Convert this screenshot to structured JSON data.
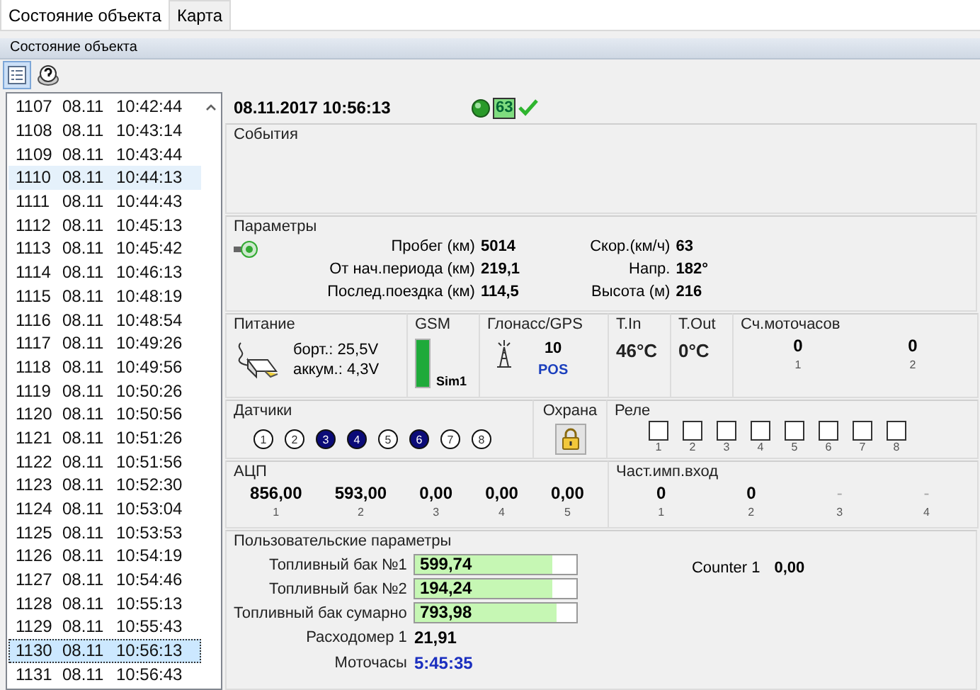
{
  "tabs": [
    {
      "label": "Состояние объекта",
      "selected": true
    },
    {
      "label": "Карта",
      "selected": false
    }
  ],
  "panel_title": "Состояние объекта",
  "toolbar": [
    {
      "kind": "list",
      "selected": true
    },
    {
      "kind": "help",
      "selected": false
    }
  ],
  "records": [
    {
      "number": "1107",
      "date": "08.11",
      "time": "10:42:44",
      "selected": false,
      "hovered": false
    },
    {
      "number": "1108",
      "date": "08.11",
      "time": "10:43:14",
      "selected": false,
      "hovered": false
    },
    {
      "number": "1109",
      "date": "08.11",
      "time": "10:43:44",
      "selected": false,
      "hovered": false
    },
    {
      "number": "1110",
      "date": "08.11",
      "time": "10:44:13",
      "selected": false,
      "hovered": true
    },
    {
      "number": "1111",
      "date": "08.11",
      "time": "10:44:43",
      "selected": false,
      "hovered": false
    },
    {
      "number": "1112",
      "date": "08.11",
      "time": "10:45:13",
      "selected": false,
      "hovered": false
    },
    {
      "number": "1113",
      "date": "08.11",
      "time": "10:45:42",
      "selected": false,
      "hovered": false
    },
    {
      "number": "1114",
      "date": "08.11",
      "time": "10:46:13",
      "selected": false,
      "hovered": false
    },
    {
      "number": "1115",
      "date": "08.11",
      "time": "10:48:19",
      "selected": false,
      "hovered": false
    },
    {
      "number": "1116",
      "date": "08.11",
      "time": "10:48:54",
      "selected": false,
      "hovered": false
    },
    {
      "number": "1117",
      "date": "08.11",
      "time": "10:49:26",
      "selected": false,
      "hovered": false
    },
    {
      "number": "1118",
      "date": "08.11",
      "time": "10:49:56",
      "selected": false,
      "hovered": false
    },
    {
      "number": "1119",
      "date": "08.11",
      "time": "10:50:26",
      "selected": false,
      "hovered": false
    },
    {
      "number": "1120",
      "date": "08.11",
      "time": "10:50:56",
      "selected": false,
      "hovered": false
    },
    {
      "number": "1121",
      "date": "08.11",
      "time": "10:51:26",
      "selected": false,
      "hovered": false
    },
    {
      "number": "1122",
      "date": "08.11",
      "time": "10:51:56",
      "selected": false,
      "hovered": false
    },
    {
      "number": "1123",
      "date": "08.11",
      "time": "10:52:30",
      "selected": false,
      "hovered": false
    },
    {
      "number": "1124",
      "date": "08.11",
      "time": "10:53:04",
      "selected": false,
      "hovered": false
    },
    {
      "number": "1125",
      "date": "08.11",
      "time": "10:53:53",
      "selected": false,
      "hovered": false
    },
    {
      "number": "1126",
      "date": "08.11",
      "time": "10:54:19",
      "selected": false,
      "hovered": false
    },
    {
      "number": "1127",
      "date": "08.11",
      "time": "10:54:46",
      "selected": false,
      "hovered": false
    },
    {
      "number": "1128",
      "date": "08.11",
      "time": "10:55:13",
      "selected": false,
      "hovered": false
    },
    {
      "number": "1129",
      "date": "08.11",
      "time": "10:55:43",
      "selected": false,
      "hovered": false
    },
    {
      "number": "1130",
      "date": "08.11",
      "time": "10:56:13",
      "selected": true,
      "hovered": false
    },
    {
      "number": "1131",
      "date": "08.11",
      "time": "10:56:43",
      "selected": false,
      "hovered": false
    }
  ],
  "details": {
    "timestamp": "08.11.2017 10:56:13",
    "satellites": "63",
    "events": {
      "title": "События"
    },
    "parameters": {
      "title": "Параметры",
      "left": [
        {
          "label": "Пробег (км)",
          "value": "5014"
        },
        {
          "label": "От нач.периода (км)",
          "value": "219,1"
        },
        {
          "label": "Послед.поездка (км)",
          "value": "114,5"
        }
      ],
      "right": [
        {
          "label": "Скор.(км/ч)",
          "value": "63"
        },
        {
          "label": "Напр.",
          "value": "182°"
        },
        {
          "label": "Высота (м)",
          "value": "216"
        }
      ]
    },
    "power": {
      "title": "Питание",
      "onboard": "борт.: 25,5V",
      "battery": "аккум.: 4,3V"
    },
    "gsm": {
      "title": "GSM",
      "sim": "Sim1",
      "level": 1
    },
    "gnss": {
      "title": "Глонасс/GPS",
      "satellites": "10",
      "status": "POS"
    },
    "t_in": {
      "title": "T.In",
      "value": "46°C"
    },
    "t_out": {
      "title": "T.Out",
      "value": "0°C"
    },
    "engine_hours": {
      "title": "Сч.моточасов",
      "counters": [
        {
          "value": "0",
          "index": "1"
        },
        {
          "value": "0",
          "index": "2"
        }
      ]
    },
    "sensors": {
      "title": "Датчики",
      "items": [
        {
          "label": "1",
          "on": false
        },
        {
          "label": "2",
          "on": false
        },
        {
          "label": "3",
          "on": true
        },
        {
          "label": "4",
          "on": true
        },
        {
          "label": "5",
          "on": false
        },
        {
          "label": "6",
          "on": true
        },
        {
          "label": "7",
          "on": false
        },
        {
          "label": "8",
          "on": false
        }
      ]
    },
    "security": {
      "title": "Охрана"
    },
    "relays": {
      "title": "Реле",
      "items": [
        {
          "label": "1",
          "checked": false
        },
        {
          "label": "2",
          "checked": false
        },
        {
          "label": "3",
          "checked": false
        },
        {
          "label": "4",
          "checked": false
        },
        {
          "label": "5",
          "checked": false
        },
        {
          "label": "6",
          "checked": false
        },
        {
          "label": "7",
          "checked": false
        },
        {
          "label": "8",
          "checked": false
        }
      ]
    },
    "adc": {
      "title": "АЦП",
      "channels": [
        {
          "value": "856,00",
          "index": "1"
        },
        {
          "value": "593,00",
          "index": "2"
        },
        {
          "value": "0,00",
          "index": "3"
        },
        {
          "value": "0,00",
          "index": "4"
        },
        {
          "value": "0,00",
          "index": "5"
        }
      ]
    },
    "pulse_inputs": {
      "title": "Част.имп.вход",
      "channels": [
        {
          "value": "0",
          "index": "1",
          "disabled": false
        },
        {
          "value": "0",
          "index": "2",
          "disabled": false
        },
        {
          "value": "-",
          "index": "3",
          "disabled": true
        },
        {
          "value": "-",
          "index": "4",
          "disabled": true
        }
      ]
    },
    "user_params": {
      "title": "Пользовательские параметры",
      "tanks": [
        {
          "label": "Топливный бак №1",
          "value": "599,74",
          "level": 0.85
        },
        {
          "label": "Топливный бак №2",
          "value": "194,24",
          "level": 0.85
        },
        {
          "label": "Топливный бак сумарно",
          "value": "793,98",
          "level": 0.87
        }
      ],
      "rows": [
        {
          "label": "Расходомер 1",
          "value": "21,91",
          "kind": "plain"
        },
        {
          "label": "Моточасы",
          "value": "5:45:35",
          "kind": "time"
        }
      ],
      "counter": {
        "label": "Counter 1",
        "value": "0,00"
      }
    }
  }
}
